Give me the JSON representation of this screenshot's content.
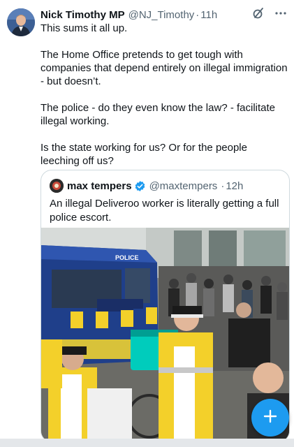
{
  "tweet": {
    "author_name": "Nick Timothy MP",
    "handle": "@NJ_Timothy",
    "separator": "·",
    "time": "11h",
    "paragraphs": [
      "This sums it all up.",
      "The Home Office pretends to get tough with companies that depend entirely on illegal immigration - but doesn’t.",
      "The police - do they even know the law? - facilitate illegal working.",
      "Is the state working for us? Or for the people leeching off us?"
    ]
  },
  "quote": {
    "author_name": "max tempers",
    "handle": "@maxtempers",
    "separator": "·",
    "time": "12h",
    "text": "An illegal Deliveroo worker is literally getting a full police escort.",
    "media": {
      "van_sign": "POLICE"
    }
  },
  "icons": {
    "grok": "slash-circle-icon",
    "more": "more-dots-icon",
    "verified": "verified-badge-icon",
    "compose": "plus-icon"
  },
  "colors": {
    "accent": "#1d9bf0",
    "secondary_text": "#536471",
    "border": "#cfd9de"
  }
}
